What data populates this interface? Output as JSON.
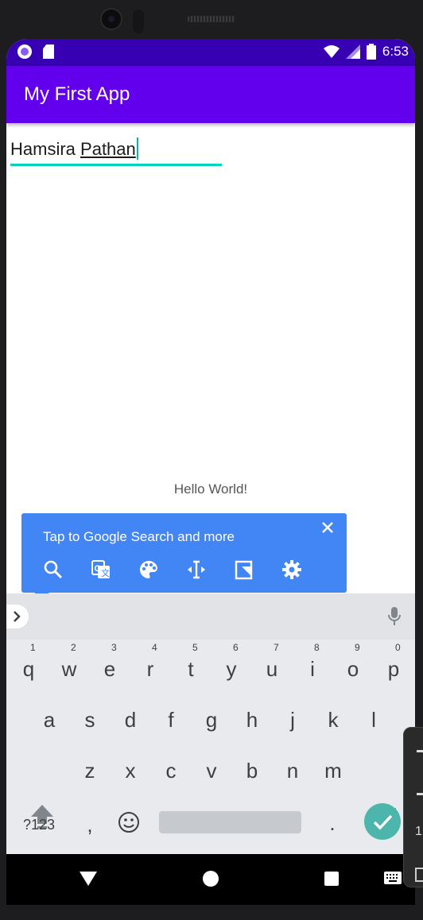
{
  "status_bar": {
    "time": "6:53"
  },
  "app_bar": {
    "title": "My First App"
  },
  "edit_field": {
    "value_first": "Hamsira",
    "value_underlined": "Pathan"
  },
  "content": {
    "hello_text": "Hello World!"
  },
  "tooltip": {
    "text": "Tap to Google Search and more",
    "icons": [
      "search-icon",
      "translate-icon",
      "palette-icon",
      "text-cursor-icon",
      "dictionary-icon",
      "settings-icon"
    ]
  },
  "keyboard": {
    "row1": [
      {
        "k": "q",
        "n": "1"
      },
      {
        "k": "w",
        "n": "2"
      },
      {
        "k": "e",
        "n": "3"
      },
      {
        "k": "r",
        "n": "4"
      },
      {
        "k": "t",
        "n": "5"
      },
      {
        "k": "y",
        "n": "6"
      },
      {
        "k": "u",
        "n": "7"
      },
      {
        "k": "i",
        "n": "8"
      },
      {
        "k": "o",
        "n": "9"
      },
      {
        "k": "p",
        "n": "0"
      }
    ],
    "row2": [
      "a",
      "s",
      "d",
      "f",
      "g",
      "h",
      "j",
      "k",
      "l"
    ],
    "row3": [
      "z",
      "x",
      "c",
      "v",
      "b",
      "n",
      "m"
    ],
    "symbols_label": "?123",
    "comma": ",",
    "period": "."
  },
  "side_panel": {
    "digit": "1"
  },
  "colors": {
    "status_bar": "#3700b3",
    "app_bar": "#6200ee",
    "accent": "#03d3c0",
    "tooltip": "#4285f4",
    "enter_key": "#4db6ac"
  }
}
